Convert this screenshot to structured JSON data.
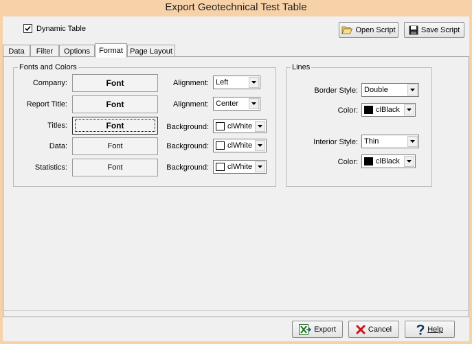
{
  "window": {
    "title": "Export Geotechnical Test Table"
  },
  "top": {
    "dynamic_table_label": "Dynamic Table",
    "dynamic_table_checked": true,
    "open_script_label": "Open Script",
    "save_script_label": "Save Script"
  },
  "tabs": [
    {
      "label": "Data"
    },
    {
      "label": "Filter"
    },
    {
      "label": "Options"
    },
    {
      "label": "Format"
    },
    {
      "label": "Page Layout"
    }
  ],
  "fonts_group": {
    "title": "Fonts and Colors",
    "rows": [
      {
        "label": "Company:",
        "button": "Font",
        "option_label": "Alignment:",
        "option_value": "Left"
      },
      {
        "label": "Report Title:",
        "button": "Font",
        "option_label": "Alignment:",
        "option_value": "Center"
      },
      {
        "label": "Titles:",
        "button": "Font",
        "option_label": "Background:",
        "option_value": "clWhite",
        "swatch": "#ffffff"
      },
      {
        "label": "Data:",
        "button": "Font",
        "option_label": "Background:",
        "option_value": "clWhite",
        "swatch": "#ffffff"
      },
      {
        "label": "Statistics:",
        "button": "Font",
        "option_label": "Background:",
        "option_value": "clWhite",
        "swatch": "#ffffff"
      }
    ]
  },
  "lines_group": {
    "title": "Lines",
    "border_style_label": "Border Style:",
    "border_style_value": "Double",
    "border_color_label": "Color:",
    "border_color_value": "clBlack",
    "border_color_swatch": "#000000",
    "interior_style_label": "Interior Style:",
    "interior_style_value": "Thin",
    "interior_color_label": "Color:",
    "interior_color_value": "clBlack",
    "interior_color_swatch": "#000000"
  },
  "footer": {
    "export_label": "Export",
    "cancel_label": "Cancel",
    "help_label": "Help"
  }
}
